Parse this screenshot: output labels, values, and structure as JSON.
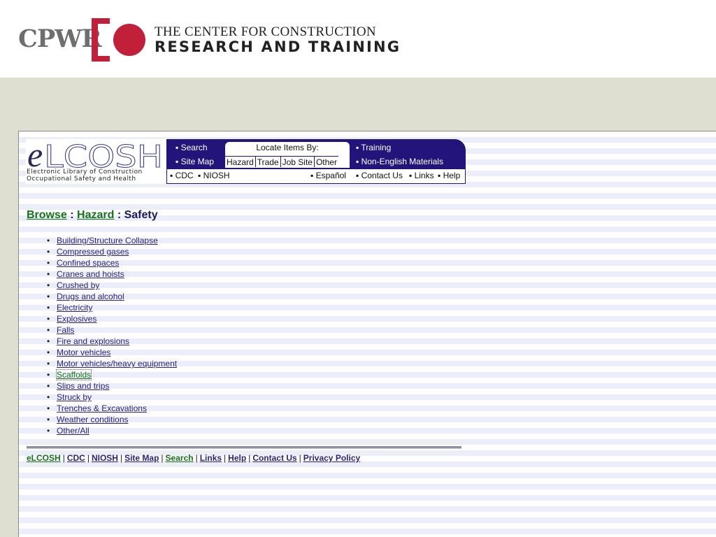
{
  "cpwr": {
    "wordmark": "CPWR",
    "line1": "THE CENTER FOR CONSTRUCTION",
    "line2": "RESEARCH AND TRAINING",
    "colors": {
      "red": "#c0203a",
      "grey": "#6e6e6e"
    }
  },
  "elcosh": {
    "logo_e": "e",
    "logo_rest": "LCOSH",
    "subtitle_line1": "Electronic Library of Construction",
    "subtitle_line2": "Occupational Safety and Health",
    "nav": {
      "search": "▪ Search",
      "site_map": "▪ Site Map",
      "locate_title": "Locate Items By:",
      "locate_items": [
        "Hazard",
        "Trade",
        "Job Site",
        "Other"
      ],
      "training": "▪ Training",
      "non_english": "▪ Non-English Materials",
      "cdc": "▪ CDC",
      "niosh": "▪ NIOSH",
      "espanol": "▪ Español",
      "contact_us": "▪ Contact Us",
      "links": "▪ Links",
      "help": "▪ Help"
    },
    "colors": {
      "nav_bg": "#22147a",
      "link": "#2c2278",
      "visited": "#17701b"
    }
  },
  "breadcrumb": {
    "browse": "Browse",
    "sep1": " : ",
    "hazard": "Hazard",
    "sep2": " : ",
    "current": "Safety"
  },
  "hazards": [
    "Building/Structure Collapse",
    "Compressed gases",
    "Confined spaces",
    "Cranes and hoists",
    "Crushed by",
    "Drugs and alcohol",
    "Electricity",
    "Explosives",
    "Falls",
    "Fire and explosions",
    "Motor vehicles",
    "Motor vehicles/heavy equipment",
    "Scaffolds",
    "Slips and trips",
    "Struck by",
    "Trenches & Excavations",
    "Weather conditions",
    "Other/All"
  ],
  "bullet": "•",
  "footer": {
    "links": [
      "eLCOSH",
      "CDC",
      "NIOSH",
      "Site Map",
      "Search",
      "Links",
      "Help",
      "Contact Us",
      "Privacy Policy"
    ],
    "separator": "|"
  }
}
